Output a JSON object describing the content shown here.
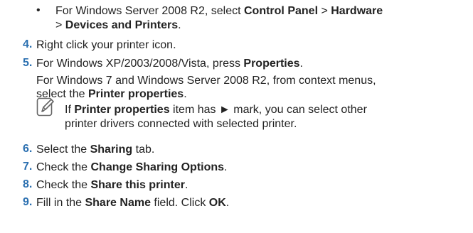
{
  "bullet": {
    "mark": "•",
    "line1_prefix": "For Windows Server 2008 R2, select ",
    "control_panel": "Control Panel",
    "sep1": " > ",
    "hardware": "Hardware",
    "line2_prefix": "> ",
    "devices_printers": "Devices and Printers",
    "line2_suffix": "."
  },
  "steps": {
    "s4": {
      "num": "4.",
      "text": "Right click your printer icon."
    },
    "s5": {
      "num": "5.",
      "prefix": "For Windows XP/2003/2008/Vista, press ",
      "bold": "Properties",
      "suffix": ".",
      "sub1": "For Windows 7 and Windows Server 2008 R2, from context menus,",
      "sub2_prefix": "select the ",
      "sub2_bold": "Printer properties",
      "sub2_suffix": "."
    },
    "s6": {
      "num": "6.",
      "prefix": "Select the ",
      "bold": "Sharing",
      "suffix": " tab."
    },
    "s7": {
      "num": "7.",
      "prefix": "Check the ",
      "bold": "Change Sharing Options",
      "suffix": "."
    },
    "s8": {
      "num": "8.",
      "prefix": "Check the ",
      "bold": "Share this printer",
      "suffix": "."
    },
    "s9": {
      "num": "9.",
      "prefix": "Fill in the ",
      "bold": "Share Name",
      "mid": " field. Click ",
      "bold2": "OK",
      "suffix": "."
    }
  },
  "note": {
    "icon": "note-pencil-icon",
    "prefix": "If ",
    "bold": "Printer properties",
    "mid": " item has ► mark, you can select other",
    "line2": "printer drivers connected with selected printer."
  }
}
